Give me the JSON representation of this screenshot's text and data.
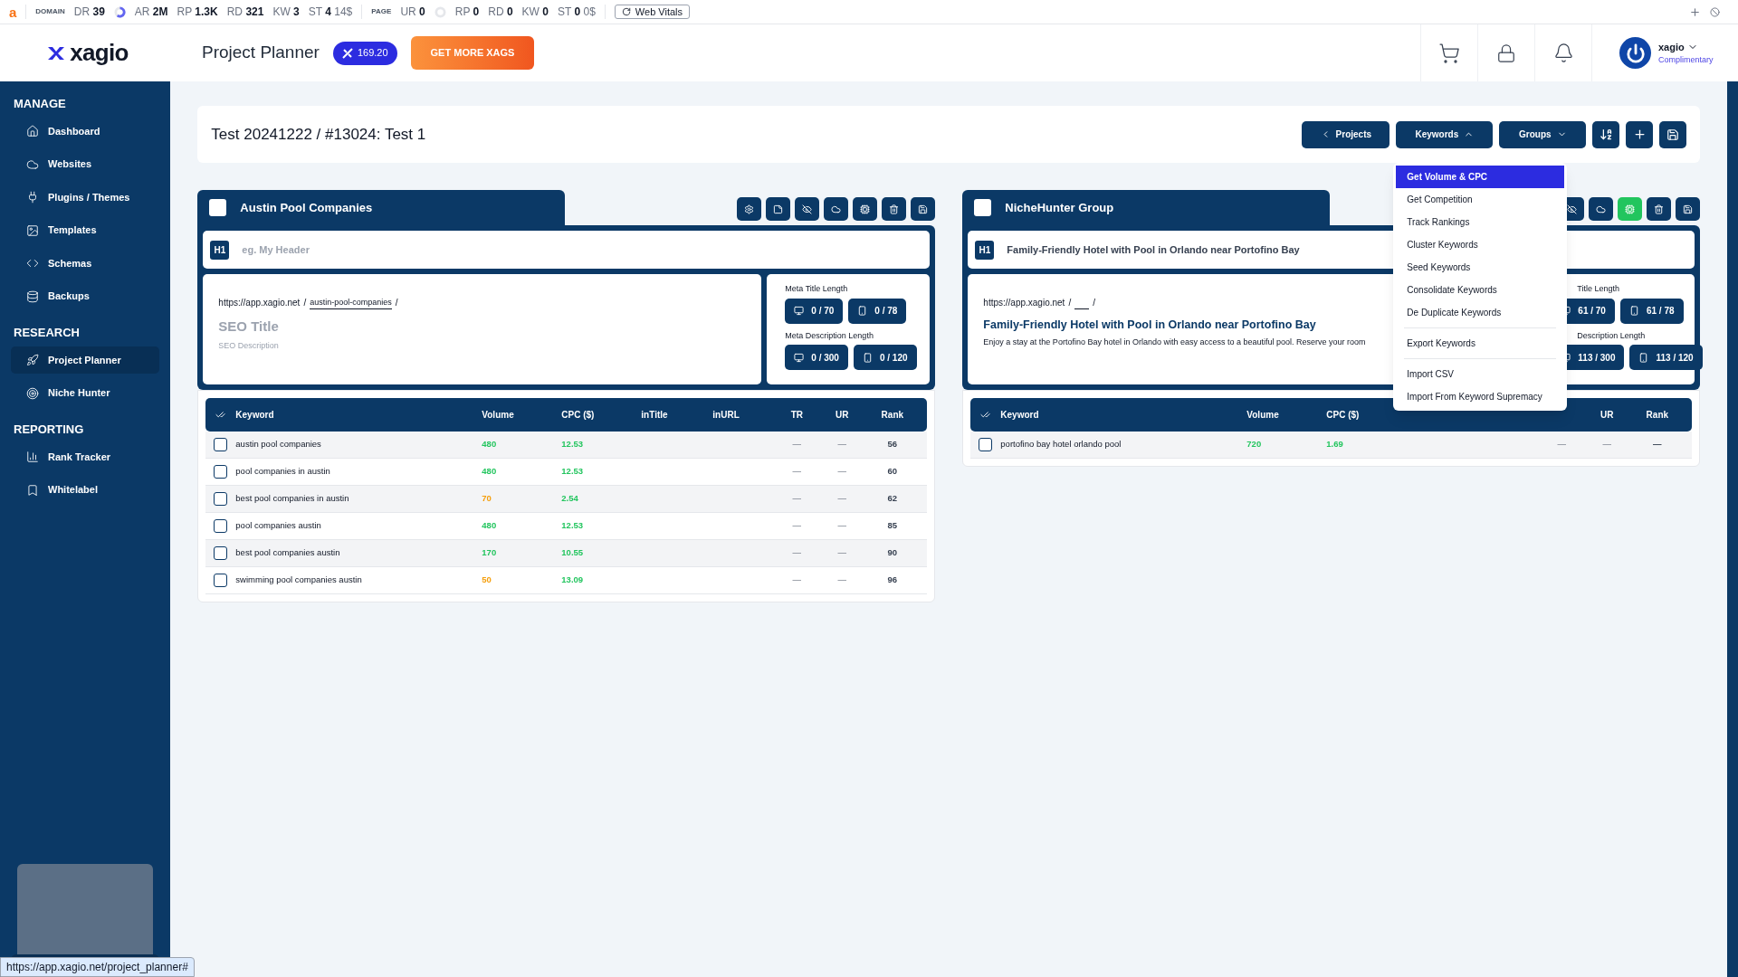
{
  "seo_bar": {
    "logo": "a",
    "domain_label": "DOMAIN",
    "domain_metrics": [
      {
        "label": "DR",
        "value": "39"
      },
      {
        "label": "AR",
        "value": "2M"
      },
      {
        "label": "RP",
        "value": "1.3K"
      },
      {
        "label": "RD",
        "value": "321"
      },
      {
        "label": "KW",
        "value": "3"
      },
      {
        "label": "ST",
        "value": "4",
        "extra": "14$"
      }
    ],
    "page_label": "PAGE",
    "page_metrics": [
      {
        "label": "UR",
        "value": "0"
      },
      {
        "label": "RP",
        "value": "0"
      },
      {
        "label": "RD",
        "value": "0"
      },
      {
        "label": "KW",
        "value": "0"
      },
      {
        "label": "ST",
        "value": "0",
        "extra": "0$"
      }
    ],
    "web_vitals": "Web Vitals"
  },
  "header": {
    "logo": "xagio",
    "title": "Project Planner",
    "credits": "169.20",
    "cta": "GET MORE XAGS",
    "user": {
      "name": "xagio",
      "plan": "Complimentary"
    }
  },
  "sidebar": {
    "sections": [
      {
        "title": "MANAGE",
        "items": [
          {
            "label": "Dashboard",
            "selected": false
          },
          {
            "label": "Websites",
            "selected": false
          },
          {
            "label": "Plugins / Themes",
            "selected": false
          },
          {
            "label": "Templates",
            "selected": false
          },
          {
            "label": "Schemas",
            "selected": false
          },
          {
            "label": "Backups",
            "selected": false
          }
        ]
      },
      {
        "title": "RESEARCH",
        "items": [
          {
            "label": "Project Planner",
            "selected": true
          },
          {
            "label": "Niche Hunter",
            "selected": false
          }
        ]
      },
      {
        "title": "REPORTING",
        "items": [
          {
            "label": "Rank Tracker",
            "selected": false
          },
          {
            "label": "Whitelabel",
            "selected": false
          }
        ]
      }
    ]
  },
  "project": {
    "title": "Test 20241222 / #13024: Test 1",
    "buttons": [
      {
        "label": "Projects",
        "kind": "back"
      },
      {
        "label": "Keywords",
        "kind": "up"
      },
      {
        "label": "Groups",
        "kind": "down"
      }
    ]
  },
  "keywords_menu": {
    "groups": [
      [
        {
          "label": "Get Volume & CPC",
          "selected": true
        },
        {
          "label": "Get Competition",
          "selected": false
        },
        {
          "label": "Track Rankings",
          "selected": false
        },
        {
          "label": "Cluster Keywords",
          "selected": false
        },
        {
          "label": "Seed Keywords",
          "selected": false
        },
        {
          "label": "Consolidate Keywords",
          "selected": false
        },
        {
          "label": "De Duplicate Keywords",
          "selected": false
        }
      ],
      [
        {
          "label": "Export Keywords",
          "selected": false
        }
      ],
      [
        {
          "label": "Import CSV",
          "selected": false
        },
        {
          "label": "Import From Keyword Supremacy",
          "selected": false
        }
      ]
    ]
  },
  "groups": [
    {
      "name": "Austin Pool Companies",
      "checked": false,
      "ai_active": false,
      "h1_tag": "H1",
      "h1": {
        "placeholder": "eg. My Header"
      },
      "url": "https://app.xagio.net",
      "url_separator": "/",
      "slug": "austin-pool-companies",
      "seo_title": {
        "placeholder": "SEO Title"
      },
      "seo_description": {
        "placeholder": "SEO Description"
      },
      "meta_title_label": "Meta Title Length",
      "meta_title": [
        "0 / 70",
        "0 / 78"
      ],
      "meta_description_label": "Meta Description Length",
      "meta_description": [
        "0 / 300",
        "0 / 120"
      ],
      "columns": [
        "Keyword",
        "Volume",
        "CPC ($)",
        "inTitle",
        "inURL",
        "TR",
        "UR",
        "Rank"
      ],
      "rows": [
        {
          "checked": false,
          "keyword": "austin pool companies",
          "volume": {
            "value": "480",
            "color": "#22c55e"
          },
          "cpc": "12.53",
          "tr": "—",
          "ur": "—",
          "rank": "56"
        },
        {
          "checked": false,
          "keyword": "pool companies in austin",
          "volume": {
            "value": "480",
            "color": "#22c55e"
          },
          "cpc": "12.53",
          "tr": "—",
          "ur": "—",
          "rank": "60"
        },
        {
          "checked": false,
          "keyword": "best pool companies in austin",
          "volume": {
            "value": "70",
            "color": "#f59e0b"
          },
          "cpc": "2.54",
          "tr": "—",
          "ur": "—",
          "rank": "62"
        },
        {
          "checked": false,
          "keyword": "pool companies austin",
          "volume": {
            "value": "480",
            "color": "#22c55e"
          },
          "cpc": "12.53",
          "tr": "—",
          "ur": "—",
          "rank": "85"
        },
        {
          "checked": false,
          "keyword": "best pool companies austin",
          "volume": {
            "value": "170",
            "color": "#22c55e"
          },
          "cpc": "10.55",
          "tr": "—",
          "ur": "—",
          "rank": "90"
        },
        {
          "checked": false,
          "keyword": "swimming pool companies austin",
          "volume": {
            "value": "50",
            "color": "#f59e0b"
          },
          "cpc": "13.09",
          "tr": "—",
          "ur": "—",
          "rank": "96"
        }
      ]
    },
    {
      "name": "NicheHunter Group",
      "checked": false,
      "ai_active": true,
      "h1_tag": "H1",
      "h1": {
        "value": "Family-Friendly Hotel with Pool in Orlando near Portofino Bay"
      },
      "url": "https://app.xagio.net",
      "url_separator": "/",
      "seo_title": {
        "value": "Family-Friendly Hotel with Pool in Orlando near Portofino Bay"
      },
      "seo_description": {
        "value": "Enjoy a stay at the Portofino Bay hotel in Orlando with easy access to a beautiful pool. Reserve your room"
      },
      "meta_title_label": "Title Length",
      "meta_title": [
        "61 / 70",
        "61 / 78"
      ],
      "meta_description_label": "Description Length",
      "meta_description": [
        "113 / 300",
        "113 / 120"
      ],
      "columns": [
        "Keyword",
        "Volume",
        "CPC ($)",
        "UR",
        "Rank"
      ],
      "rows": [
        {
          "checked": false,
          "keyword": "portofino bay hotel orlando pool",
          "volume": {
            "value": "720",
            "color": "#22c55e"
          },
          "cpc": "1.69",
          "tr": "—",
          "ur": "—",
          "rank": "—"
        }
      ]
    }
  ],
  "status_url": "https://app.xagio.net/project_planner#"
}
